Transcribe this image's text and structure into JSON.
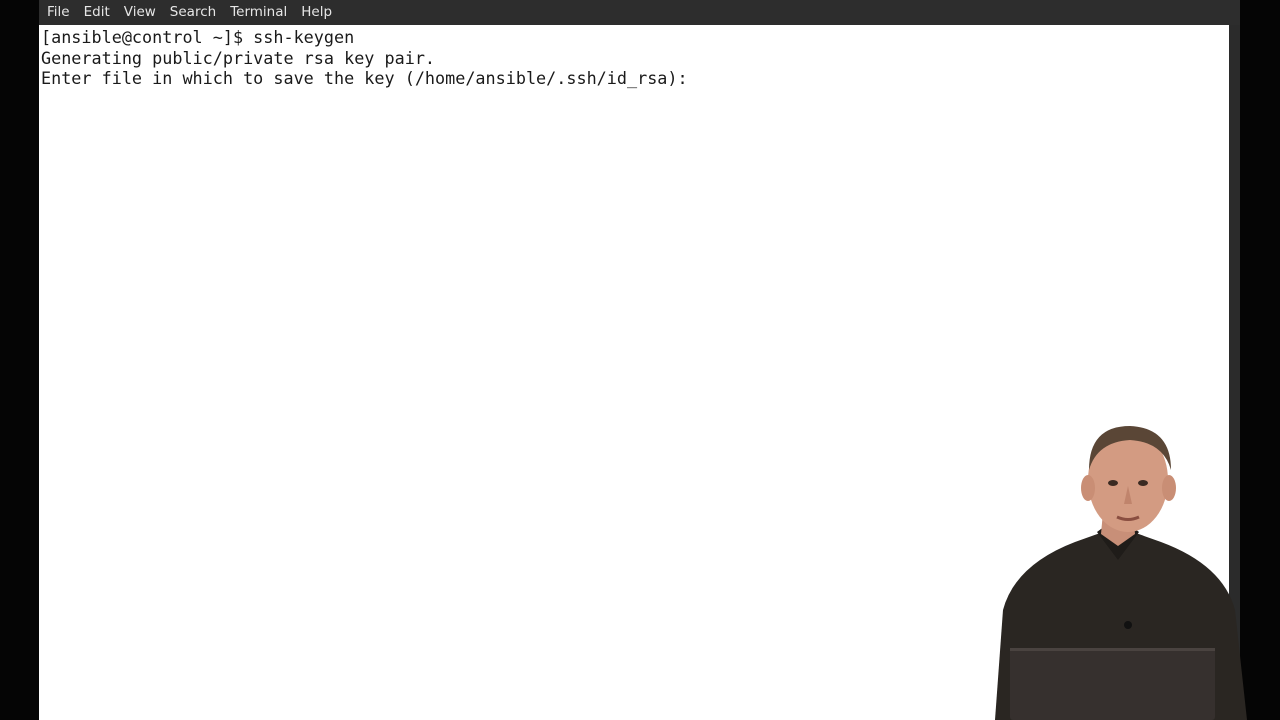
{
  "menu": {
    "items": [
      {
        "label": "File"
      },
      {
        "label": "Edit"
      },
      {
        "label": "View"
      },
      {
        "label": "Search"
      },
      {
        "label": "Terminal"
      },
      {
        "label": "Help"
      }
    ]
  },
  "terminal": {
    "lines": [
      "[ansible@control ~]$ ssh-keygen",
      "Generating public/private rsa key pair.",
      "Enter file in which to save the key (/home/ansible/.ssh/id_rsa): "
    ]
  },
  "colors": {
    "menubar_bg": "#2d2d2d",
    "terminal_bg": "#ffffff",
    "terminal_fg": "#1a1a1a",
    "frame_bg": "#000000"
  }
}
